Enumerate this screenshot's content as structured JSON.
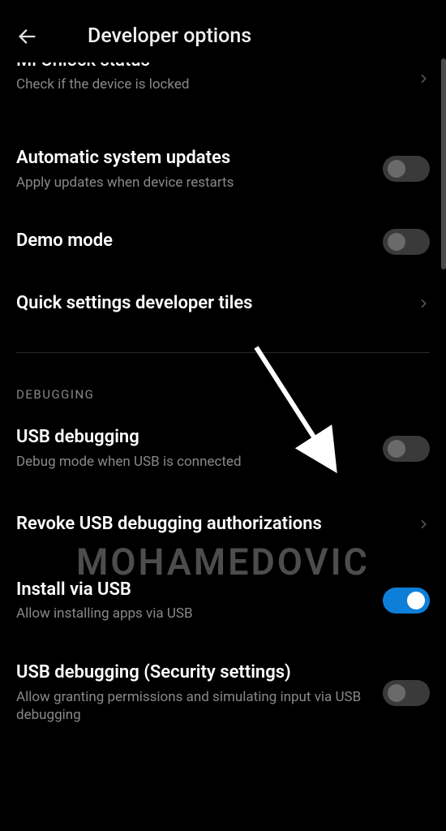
{
  "header": {
    "title": "Developer options"
  },
  "items": {
    "unlock_status": {
      "title": "Mi Unlock status",
      "subtitle": "Check if the device is locked"
    },
    "auto_updates": {
      "title": "Automatic system updates",
      "subtitle": "Apply updates when device restarts"
    },
    "demo_mode": {
      "title": "Demo mode"
    },
    "quick_tiles": {
      "title": "Quick settings developer tiles"
    },
    "usb_debugging": {
      "title": "USB debugging",
      "subtitle": "Debug mode when USB is connected"
    },
    "revoke": {
      "title": "Revoke USB debugging authorizations"
    },
    "install_usb": {
      "title": "Install via USB",
      "subtitle": "Allow installing apps via USB"
    },
    "usb_security": {
      "title": "USB debugging (Security settings)",
      "subtitle": "Allow granting permissions and simulating input via USB debugging"
    }
  },
  "section": {
    "debugging": "DEBUGGING"
  },
  "watermark": "MOHAMEDOVIC"
}
